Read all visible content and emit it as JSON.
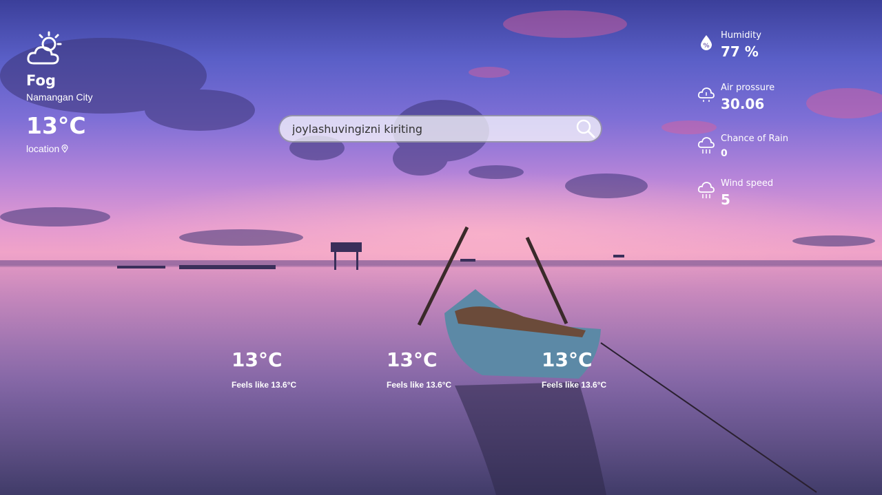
{
  "current": {
    "icon": "sun-cloud-icon",
    "condition": "Fog",
    "city": "Namangan City",
    "temperature": "13°C",
    "location_label": "location",
    "location_icon": "map-pin-icon"
  },
  "search": {
    "placeholder": "joylashuvingizni kiriting",
    "icon": "search-icon"
  },
  "stats": [
    {
      "icon": "humidity-drop-icon",
      "label": "Humidity",
      "value": "77 %"
    },
    {
      "icon": "cloud-pressure-icon",
      "label": "Air prossure",
      "value": "30.06"
    },
    {
      "icon": "rain-cloud-icon",
      "label": "Chance of Rain",
      "value": "0"
    },
    {
      "icon": "rain-cloud-icon",
      "label": "Wind speed",
      "value": "5"
    }
  ],
  "forecast": [
    {
      "temperature": "13°C",
      "feels_like": "Feels like 13.6°C"
    },
    {
      "temperature": "13°C",
      "feels_like": "Feels like 13.6°C"
    },
    {
      "temperature": "13°C",
      "feels_like": "Feels like 13.6°C"
    }
  ],
  "colors": {
    "text": "#ffffff",
    "search_bg": "#e8dcee",
    "sky_top": "#3b3f9a",
    "horizon": "#f0a3c8",
    "water_bottom": "#4a4376"
  }
}
